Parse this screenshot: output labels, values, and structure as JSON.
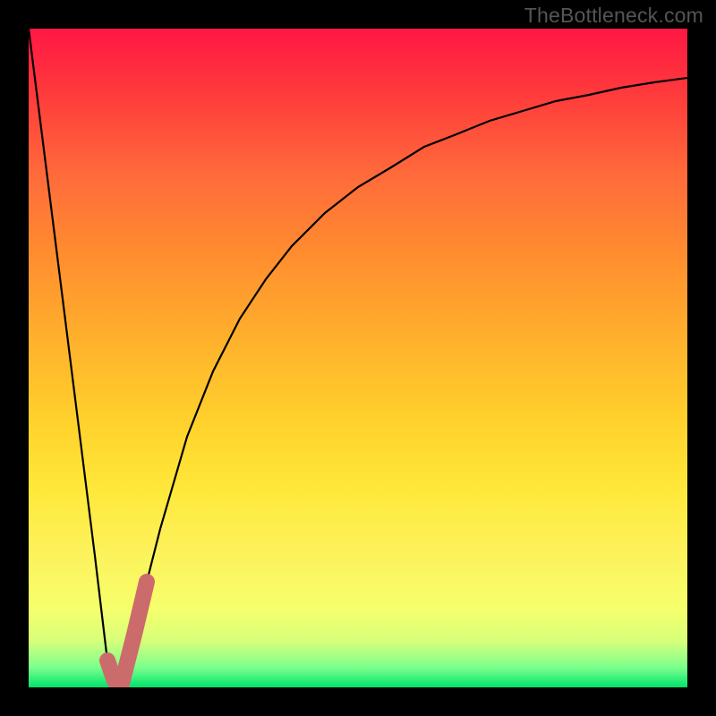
{
  "watermark": "TheBottleneck.com",
  "chart_data": {
    "type": "line",
    "title": "",
    "xlabel": "",
    "ylabel": "",
    "xlim": [
      0,
      100
    ],
    "ylim": [
      0,
      100
    ],
    "series": [
      {
        "name": "bottleneck-curve",
        "x": [
          0,
          5,
          10,
          12,
          14,
          16,
          18,
          20,
          24,
          28,
          32,
          36,
          40,
          45,
          50,
          55,
          60,
          65,
          70,
          75,
          80,
          85,
          90,
          95,
          100
        ],
        "y": [
          100,
          60,
          20,
          4,
          0,
          8,
          16,
          24,
          38,
          48,
          56,
          62,
          67,
          72,
          76,
          79,
          82,
          84,
          86,
          87.5,
          89,
          90,
          91,
          91.8,
          92.5
        ]
      },
      {
        "name": "highlight-segment",
        "x": [
          12,
          13,
          14,
          16,
          18
        ],
        "y": [
          4,
          1,
          0,
          8,
          16
        ]
      }
    ],
    "gradient_stops": [
      {
        "pos": 0.0,
        "color": "#ff1744"
      },
      {
        "pos": 0.5,
        "color": "#ffb32c"
      },
      {
        "pos": 0.8,
        "color": "#fdf15a"
      },
      {
        "pos": 1.0,
        "color": "#00e46a"
      }
    ],
    "highlight_color": "#cc6b6b",
    "curve_color": "#000000"
  }
}
